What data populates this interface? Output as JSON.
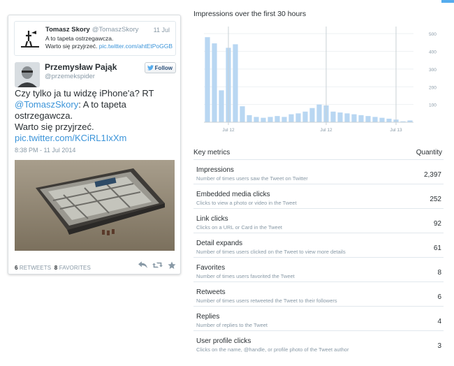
{
  "accent_color": "#55acee",
  "tweet": {
    "quoted": {
      "name": "Tomasz Skory",
      "handle": "@TomaszSkory",
      "date": "11 Jul",
      "text_line1": "A to tapeta ostrzegawcza.",
      "text_line2": "Warto się przyjrzeć.",
      "link": "pic.twitter.com/ahtEtPoGGB"
    },
    "author": {
      "name": "Przemysław Pająk",
      "handle": "@przemekspider",
      "follow_label": "Follow"
    },
    "text": {
      "part1": "Czy tylko ja tu widzę iPhone'a? RT",
      "mention": "@TomaszSkory",
      "part2": ": A to tapeta ostrzegawcza.",
      "part3": "Warto się przyjrzeć.",
      "link": "pic.twitter.com/KCiRL1IxXm"
    },
    "timestamp": "8:38 PM - 11 Jul 2014",
    "retweets_count": "6",
    "retweets_label": "RETWEETS",
    "favorites_count": "8",
    "favorites_label": "FAVORITES",
    "action_icons": [
      "reply-icon",
      "retweet-icon",
      "favorite-icon"
    ]
  },
  "chart_data": {
    "type": "bar",
    "title": "Impressions over the first 30 hours",
    "bar_color": "#b9d7f2",
    "ylim": [
      0,
      540
    ],
    "yticks": [
      100,
      200,
      300,
      400,
      500
    ],
    "x_tick_labels": [
      "Jul 12",
      "Jul 12",
      "Jul 13"
    ],
    "x_tick_positions": [
      3.5,
      17.5,
      27.5
    ],
    "values": [
      480,
      445,
      180,
      420,
      440,
      90,
      40,
      30,
      25,
      30,
      35,
      30,
      45,
      50,
      60,
      80,
      100,
      95,
      60,
      55,
      50,
      45,
      40,
      35,
      30,
      25,
      20,
      15,
      5,
      10
    ]
  },
  "metrics": {
    "header_label": "Key metrics",
    "header_quantity": "Quantity",
    "rows": [
      {
        "title": "Impressions",
        "desc": "Number of times users saw the Tweet on Twitter",
        "value": "2,397"
      },
      {
        "title": "Embedded media clicks",
        "desc": "Clicks to view a photo or video in the Tweet",
        "value": "252"
      },
      {
        "title": "Link clicks",
        "desc": "Clicks on a URL or Card in the Tweet",
        "value": "92"
      },
      {
        "title": "Detail expands",
        "desc": "Number of times users clicked on the Tweet to view more details",
        "value": "61"
      },
      {
        "title": "Favorites",
        "desc": "Number of times users favorited the Tweet",
        "value": "8"
      },
      {
        "title": "Retweets",
        "desc": "Number of times users retweeted the Tweet to their followers",
        "value": "6"
      },
      {
        "title": "Replies",
        "desc": "Number of replies to the Tweet",
        "value": "4"
      },
      {
        "title": "User profile clicks",
        "desc": "Clicks on the name, @handle, or profile photo of the Tweet author",
        "value": "3"
      }
    ]
  }
}
